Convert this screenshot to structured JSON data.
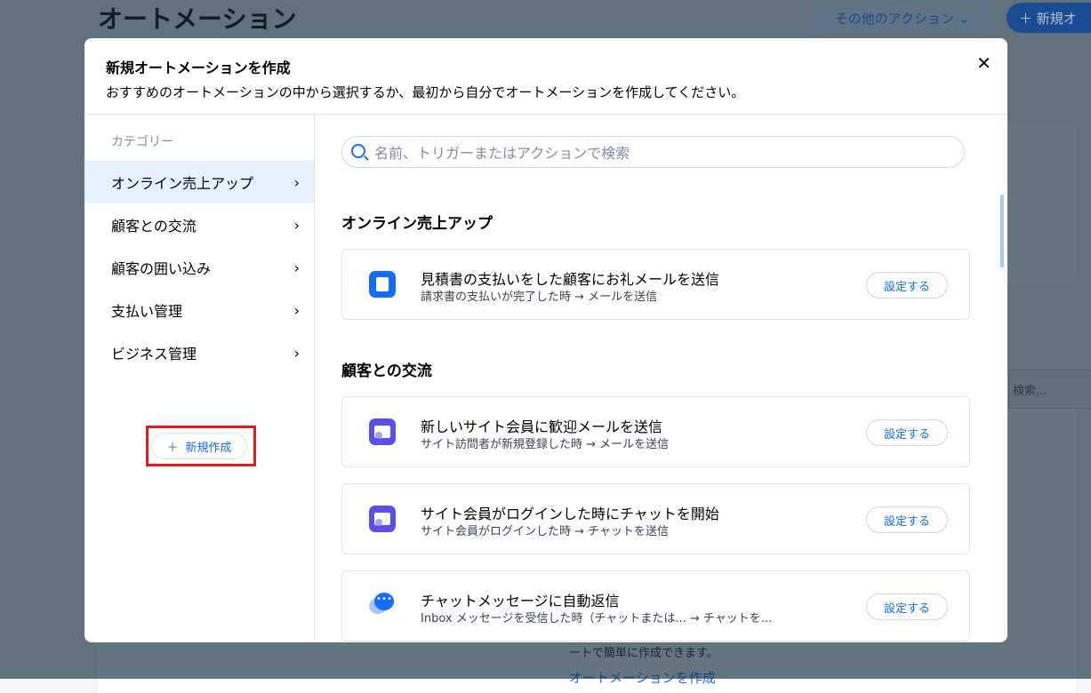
{
  "background": {
    "title": "オートメーション",
    "more_actions": "その他のアクション ⌄",
    "new_button": "＋ 新規オ",
    "search_placeholder": "検索...",
    "footer_text": "ートで簡単に作成できます。",
    "footer_link": "オートメーションを作成"
  },
  "modal": {
    "title": "新規オートメーションを作成",
    "subtitle": "おすすめのオートメーションの中から選択するか、最初から自分でオートメーションを作成してください。",
    "close": "✕",
    "sidebar": {
      "heading": "カテゴリー",
      "items": [
        {
          "label": "オンライン売上アップ",
          "active": true
        },
        {
          "label": "顧客との交流"
        },
        {
          "label": "顧客の囲い込み"
        },
        {
          "label": "支払い管理"
        },
        {
          "label": "ビジネス管理"
        }
      ],
      "new_label": "新規作成"
    },
    "search_placeholder": "名前、トリガーまたはアクションで検索",
    "sections": [
      {
        "title": "オンライン売上アップ",
        "cards": [
          {
            "title": "見積書の支払いをした顧客にお礼メールを送信",
            "subtitle": "請求書の支払いが完了した時 → メールを送信",
            "icon": "invoice-icon",
            "button": "設定する"
          }
        ]
      },
      {
        "title": "顧客との交流",
        "cards": [
          {
            "title": "新しいサイト会員に歓迎メールを送信",
            "subtitle": "サイト訪問者が新規登録した時 → メールを送信",
            "icon": "member-icon",
            "button": "設定する"
          },
          {
            "title": "サイト会員がログインした時にチャットを開始",
            "subtitle": "サイト会員がログインした時 → チャットを送信",
            "icon": "member-icon",
            "button": "設定する"
          },
          {
            "title": "チャットメッセージに自動返信",
            "subtitle": "Inbox メッセージを受信した時（チャットまたは...  → チャットを...",
            "icon": "chat-icon",
            "button": "設定する"
          }
        ]
      }
    ]
  },
  "colors": {
    "accent": "#116dff",
    "member_icon": "#5b4fe9",
    "highlight": "#e31b1b"
  }
}
